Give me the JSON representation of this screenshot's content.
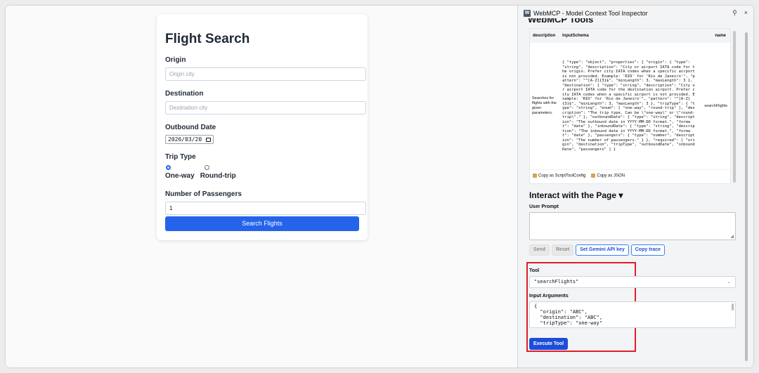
{
  "page": {
    "title": "Flight Search",
    "origin_label": "Origin",
    "origin_placeholder": "Origin city",
    "destination_label": "Destination",
    "destination_placeholder": "Destination city",
    "outbound_label": "Outbound Date",
    "outbound_value": "2026/03/20",
    "triptype_label": "Trip Type",
    "oneway_label": "One-way",
    "roundtrip_label": "Round-trip",
    "passengers_label": "Number of Passengers",
    "passengers_value": "1",
    "search_button": "Search Flights"
  },
  "panel": {
    "app_icon": "W",
    "title": "WebMCP - Model Context Tool Inspector",
    "clipped_heading": "WebMCP Tools",
    "table": {
      "headers": [
        "description",
        "inputSchema",
        "name"
      ],
      "description": "Searches for flights with the given parameters.",
      "schema": "{ \"type\": \"object\", \"properties\": { \"origin\": { \"type\": \"string\", \"description\": \"City or airport IATA code for the origin. Prefer city IATA codes when a specific airport is not provided. Example: 'RIO' for 'Rio de Janeiro'\", \"pattern\": \"^[A-Z]{3}$\", \"minLength\": 3, \"maxLength\": 3 }, \"destination\": { \"type\": \"string\", \"description\": \"City or airport IATA code for the destination airport. Prefer city IATA codes when a specific airport is not provided. Example: 'RIO' for 'Rio de Janeiro'\", \"pattern\": \"^[A-Z]{3}$\", \"minLength\": 3, \"maxLength\": 3 }, \"tripType\": { \"type\": \"string\", \"enum\": [ \"one-way\", \"round-trip\" ], \"description\": \"The trip type. Can be \\\"one-way\\\" or \\\"round-trip\\\".\" }, \"outboundDate\": { \"type\": \"string\", \"description\": \"The outbound date in YYYY-MM-DD format.\", \"format\": \"date\" }, \"inboundDate\": { \"type\": \"string\", \"description\": \"The inbound date in YYYY-MM-DD format.\", \"format\": \"date\" }, \"passengers\": { \"type\": \"number\", \"description\": \"The number of passengers.\" } }, \"required\": [ \"origin\", \"destination\", \"tripType\", \"outboundDate\", \"inboundDate\", \"passengers\" ] }",
      "name": "searchFlights"
    },
    "copy_script": "Copy as ScriptToolConfig",
    "copy_json": "Copy as JSON",
    "interact_title": "Interact with the Page ▾",
    "user_prompt_label": "User Prompt",
    "send": "Send",
    "reset": "Reset",
    "set_key": "Set Gemini API key",
    "copy_trace": "Copy trace",
    "tool_label": "Tool",
    "tool_value": "\"searchFlights\"",
    "args_label": "Input Arguments",
    "args_value": "{\n  \"origin\": \"ABC\",\n  \"destination\": \"ABC\",\n  \"tripType\": \"one-way\"",
    "execute": "Execute Tool",
    "close_glyph": "×",
    "pin_glyph": "⚲"
  },
  "colors": {
    "accent": "#2563eb",
    "highlight_box": "#e11d2a"
  }
}
